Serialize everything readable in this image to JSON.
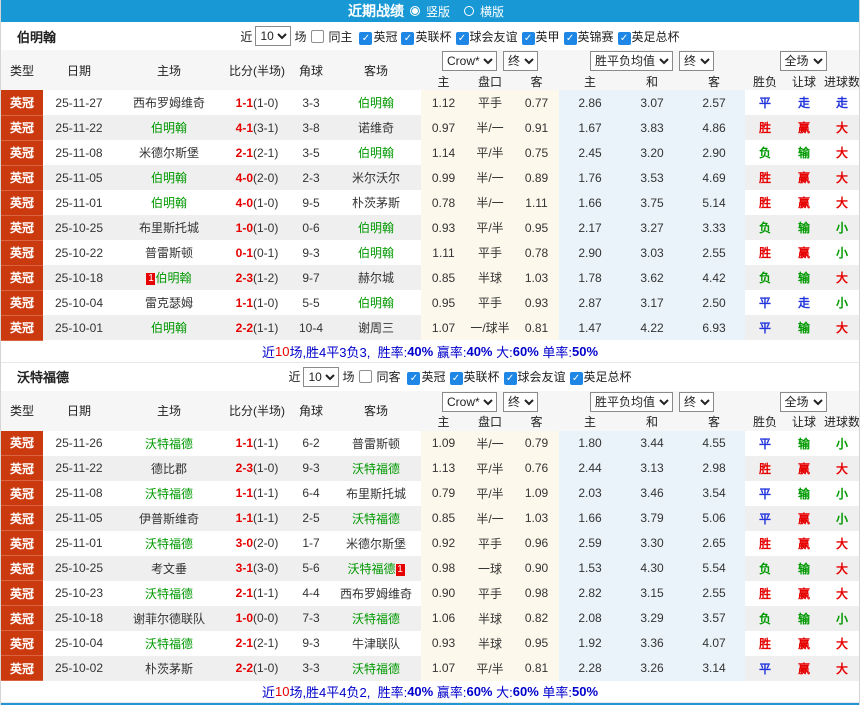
{
  "topbar": {
    "title": "近期战绩",
    "options": [
      {
        "label": "竖版",
        "selected": true
      },
      {
        "label": "横版",
        "selected": false
      }
    ]
  },
  "dropdowns": {
    "crow": "Crow*",
    "end": "终",
    "wdl": "胜平负均值",
    "full": "全场"
  },
  "columns": {
    "type": "类型",
    "date": "日期",
    "home": "主场",
    "score": "比分(半场)",
    "corner": "角球",
    "away": "客场",
    "ah_home": "主",
    "ah_line": "盘口",
    "ah_away": "客",
    "eu_home": "主",
    "eu_draw": "和",
    "eu_away": "客",
    "result": "胜负",
    "handicap_result": "让球",
    "goals_result": "进球数"
  },
  "colors": {
    "topbar": "#1899d6",
    "type_badge": "#cb3a0e",
    "focus_team": "#009900",
    "score": "#e60000",
    "win": "#e60000",
    "lose": "#009900",
    "push": "#2233dd",
    "summary": "#0000cc"
  },
  "sections": [
    {
      "team": "伯明翰",
      "filters": {
        "near": "近",
        "count": "10",
        "games": "场",
        "same": {
          "label": "同主",
          "checked": false
        },
        "leagues": [
          "英冠",
          "英联杯",
          "球会友谊",
          "英甲",
          "英锦赛",
          "英足总杯"
        ]
      },
      "rows": [
        {
          "league": "英冠",
          "date": "25-11-27",
          "home": "西布罗姆维奇",
          "hc": "",
          "score": "1-1",
          "half": "1-0",
          "corners": "3-3",
          "away": "伯明翰",
          "ac": "",
          "ah": [
            "1.12",
            "平手",
            "0.77"
          ],
          "eu": [
            "2.86",
            "3.07",
            "2.57"
          ],
          "res": [
            "平",
            "走",
            "走"
          ]
        },
        {
          "league": "英冠",
          "date": "25-11-22",
          "home": "伯明翰",
          "hc": "",
          "score": "4-1",
          "half": "3-1",
          "corners": "3-8",
          "away": "诺维奇",
          "ac": "",
          "ah": [
            "0.97",
            "半/一",
            "0.91"
          ],
          "eu": [
            "1.67",
            "3.83",
            "4.86"
          ],
          "res": [
            "胜",
            "赢",
            "大"
          ]
        },
        {
          "league": "英冠",
          "date": "25-11-08",
          "home": "米德尔斯堡",
          "hc": "",
          "score": "2-1",
          "half": "2-1",
          "corners": "3-5",
          "away": "伯明翰",
          "ac": "",
          "ah": [
            "1.14",
            "平/半",
            "0.75"
          ],
          "eu": [
            "2.45",
            "3.20",
            "2.90"
          ],
          "res": [
            "负",
            "输",
            "大"
          ]
        },
        {
          "league": "英冠",
          "date": "25-11-05",
          "home": "伯明翰",
          "hc": "",
          "score": "4-0",
          "half": "2-0",
          "corners": "2-3",
          "away": "米尔沃尔",
          "ac": "",
          "ah": [
            "0.99",
            "半/一",
            "0.89"
          ],
          "eu": [
            "1.76",
            "3.53",
            "4.69"
          ],
          "res": [
            "胜",
            "赢",
            "大"
          ]
        },
        {
          "league": "英冠",
          "date": "25-11-01",
          "home": "伯明翰",
          "hc": "",
          "score": "4-0",
          "half": "1-0",
          "corners": "9-5",
          "away": "朴茨茅斯",
          "ac": "",
          "ah": [
            "0.78",
            "半/一",
            "1.11"
          ],
          "eu": [
            "1.66",
            "3.75",
            "5.14"
          ],
          "res": [
            "胜",
            "赢",
            "大"
          ]
        },
        {
          "league": "英冠",
          "date": "25-10-25",
          "home": "布里斯托城",
          "hc": "",
          "score": "1-0",
          "half": "1-0",
          "corners": "0-6",
          "away": "伯明翰",
          "ac": "",
          "ah": [
            "0.93",
            "平/半",
            "0.95"
          ],
          "eu": [
            "2.17",
            "3.27",
            "3.33"
          ],
          "res": [
            "负",
            "输",
            "小"
          ]
        },
        {
          "league": "英冠",
          "date": "25-10-22",
          "home": "普雷斯顿",
          "hc": "",
          "score": "0-1",
          "half": "0-1",
          "corners": "9-3",
          "away": "伯明翰",
          "ac": "",
          "ah": [
            "1.11",
            "平手",
            "0.78"
          ],
          "eu": [
            "2.90",
            "3.03",
            "2.55"
          ],
          "res": [
            "胜",
            "赢",
            "小"
          ]
        },
        {
          "league": "英冠",
          "date": "25-10-18",
          "home": "伯明翰",
          "hc": "1",
          "score": "2-3",
          "half": "1-2",
          "corners": "9-7",
          "away": "赫尔城",
          "ac": "",
          "ah": [
            "0.85",
            "半球",
            "1.03"
          ],
          "eu": [
            "1.78",
            "3.62",
            "4.42"
          ],
          "res": [
            "负",
            "输",
            "大"
          ]
        },
        {
          "league": "英冠",
          "date": "25-10-04",
          "home": "雷克瑟姆",
          "hc": "",
          "score": "1-1",
          "half": "1-0",
          "corners": "5-5",
          "away": "伯明翰",
          "ac": "",
          "ah": [
            "0.95",
            "平手",
            "0.93"
          ],
          "eu": [
            "2.87",
            "3.17",
            "2.50"
          ],
          "res": [
            "平",
            "走",
            "小"
          ]
        },
        {
          "league": "英冠",
          "date": "25-10-01",
          "home": "伯明翰",
          "hc": "",
          "score": "2-2",
          "half": "1-1",
          "corners": "10-4",
          "away": "谢周三",
          "ac": "",
          "ah": [
            "1.07",
            "一/球半",
            "0.81"
          ],
          "eu": [
            "1.47",
            "4.22",
            "6.93"
          ],
          "res": [
            "平",
            "输",
            "大"
          ]
        }
      ],
      "summary": {
        "lead": "近",
        "count": "10",
        "tail": "场,胜4平3负3,",
        "stats": [
          [
            "胜率",
            "40%"
          ],
          [
            "赢率",
            "40%"
          ],
          [
            "大",
            "60%"
          ],
          [
            "单率",
            "50%"
          ]
        ]
      }
    },
    {
      "team": "沃特福德",
      "filters": {
        "near": "近",
        "count": "10",
        "games": "场",
        "same": {
          "label": "同客",
          "checked": false
        },
        "leagues": [
          "英冠",
          "英联杯",
          "球会友谊",
          "英足总杯"
        ]
      },
      "rows": [
        {
          "league": "英冠",
          "date": "25-11-26",
          "home": "沃特福德",
          "hc": "",
          "score": "1-1",
          "half": "1-1",
          "corners": "6-2",
          "away": "普雷斯顿",
          "ac": "",
          "ah": [
            "1.09",
            "半/一",
            "0.79"
          ],
          "eu": [
            "1.80",
            "3.44",
            "4.55"
          ],
          "res": [
            "平",
            "输",
            "小"
          ]
        },
        {
          "league": "英冠",
          "date": "25-11-22",
          "home": "德比郡",
          "hc": "",
          "score": "2-3",
          "half": "1-0",
          "corners": "9-3",
          "away": "沃特福德",
          "ac": "",
          "ah": [
            "1.13",
            "平/半",
            "0.76"
          ],
          "eu": [
            "2.44",
            "3.13",
            "2.98"
          ],
          "res": [
            "胜",
            "赢",
            "大"
          ]
        },
        {
          "league": "英冠",
          "date": "25-11-08",
          "home": "沃特福德",
          "hc": "",
          "score": "1-1",
          "half": "1-1",
          "corners": "6-4",
          "away": "布里斯托城",
          "ac": "",
          "ah": [
            "0.79",
            "平/半",
            "1.09"
          ],
          "eu": [
            "2.03",
            "3.46",
            "3.54"
          ],
          "res": [
            "平",
            "输",
            "小"
          ]
        },
        {
          "league": "英冠",
          "date": "25-11-05",
          "home": "伊普斯维奇",
          "hc": "",
          "score": "1-1",
          "half": "1-1",
          "corners": "2-5",
          "away": "沃特福德",
          "ac": "",
          "ah": [
            "0.85",
            "半/一",
            "1.03"
          ],
          "eu": [
            "1.66",
            "3.79",
            "5.06"
          ],
          "res": [
            "平",
            "赢",
            "小"
          ]
        },
        {
          "league": "英冠",
          "date": "25-11-01",
          "home": "沃特福德",
          "hc": "",
          "score": "3-0",
          "half": "2-0",
          "corners": "1-7",
          "away": "米德尔斯堡",
          "ac": "",
          "ah": [
            "0.92",
            "平手",
            "0.96"
          ],
          "eu": [
            "2.59",
            "3.30",
            "2.65"
          ],
          "res": [
            "胜",
            "赢",
            "大"
          ]
        },
        {
          "league": "英冠",
          "date": "25-10-25",
          "home": "考文垂",
          "hc": "",
          "score": "3-1",
          "half": "3-0",
          "corners": "5-6",
          "away": "沃特福德",
          "ac": "1",
          "ah": [
            "0.98",
            "一球",
            "0.90"
          ],
          "eu": [
            "1.53",
            "4.30",
            "5.54"
          ],
          "res": [
            "负",
            "输",
            "大"
          ]
        },
        {
          "league": "英冠",
          "date": "25-10-23",
          "home": "沃特福德",
          "hc": "",
          "score": "2-1",
          "half": "1-1",
          "corners": "4-4",
          "away": "西布罗姆维奇",
          "ac": "",
          "ah": [
            "0.90",
            "平手",
            "0.98"
          ],
          "eu": [
            "2.82",
            "3.15",
            "2.55"
          ],
          "res": [
            "胜",
            "赢",
            "大"
          ]
        },
        {
          "league": "英冠",
          "date": "25-10-18",
          "home": "谢菲尔德联队",
          "hc": "",
          "score": "1-0",
          "half": "0-0",
          "corners": "7-3",
          "away": "沃特福德",
          "ac": "",
          "ah": [
            "1.06",
            "半球",
            "0.82"
          ],
          "eu": [
            "2.08",
            "3.29",
            "3.57"
          ],
          "res": [
            "负",
            "输",
            "小"
          ]
        },
        {
          "league": "英冠",
          "date": "25-10-04",
          "home": "沃特福德",
          "hc": "",
          "score": "2-1",
          "half": "2-1",
          "corners": "9-3",
          "away": "牛津联队",
          "ac": "",
          "ah": [
            "0.93",
            "半球",
            "0.95"
          ],
          "eu": [
            "1.92",
            "3.36",
            "4.07"
          ],
          "res": [
            "胜",
            "赢",
            "大"
          ]
        },
        {
          "league": "英冠",
          "date": "25-10-02",
          "home": "朴茨茅斯",
          "hc": "",
          "score": "2-2",
          "half": "1-0",
          "corners": "3-3",
          "away": "沃特福德",
          "ac": "",
          "ah": [
            "1.07",
            "平/半",
            "0.81"
          ],
          "eu": [
            "2.28",
            "3.26",
            "3.14"
          ],
          "res": [
            "平",
            "赢",
            "大"
          ]
        }
      ],
      "summary": {
        "lead": "近",
        "count": "10",
        "tail": "场,胜4平4负2,",
        "stats": [
          [
            "胜率",
            "40%"
          ],
          [
            "赢率",
            "60%"
          ],
          [
            "大",
            "60%"
          ],
          [
            "单率",
            "50%"
          ]
        ]
      }
    }
  ]
}
